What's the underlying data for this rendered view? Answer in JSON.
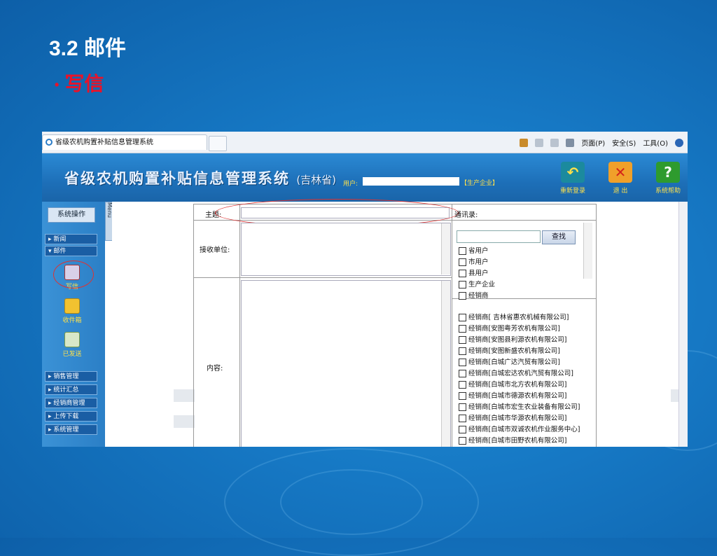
{
  "slide": {
    "title": "3.2 邮件",
    "bullet": "写信"
  },
  "browser": {
    "tab_title": "省级农机购置补贴信息管理系统",
    "tools": [
      "页面(P)",
      "安全(S)",
      "工具(O)"
    ]
  },
  "header": {
    "title": "省级农机购置补贴信息管理系统",
    "province": "(吉林省)",
    "user_label": "用户:",
    "user_role": "【生产企业】",
    "buttons": [
      {
        "label": "重新登录",
        "icon": "relogin-icon",
        "color": "#1b8a9e"
      },
      {
        "label": "退 出",
        "icon": "exit-icon",
        "color": "#e0572b"
      },
      {
        "label": "系统帮助",
        "icon": "help-icon",
        "color": "#2e9b2e"
      }
    ]
  },
  "sidebar": {
    "system_ops": "系统操作",
    "menu_tab": "Menu",
    "items_top": [
      "新闻",
      "邮件"
    ],
    "mail_actions": [
      "写信",
      "收件箱",
      "已发送"
    ],
    "items_bottom": [
      "销售管理",
      "统计汇总",
      "经销商管理",
      "上传下载",
      "系统管理"
    ]
  },
  "form": {
    "subject_label": "主题:",
    "recipient_label": "接收单位:",
    "content_label": "内容:",
    "address_book_label": "通讯录:",
    "search_button": "查找",
    "groups": [
      "省用户",
      "市用户",
      "县用户",
      "生产企业",
      "经销商"
    ],
    "dealers": [
      "经销商[ 吉林省惠农机械有限公司]",
      "经销商[安图粤芳农机有限公司]",
      "经销商[安图县利源农机有限公司]",
      "经销商[安图新盛农机有限公司]",
      "经销商[白城广达汽贸有限公司]",
      "经销商[白城宏达农机汽贸有限公司]",
      "经销商[白城市北方农机有限公司]",
      "经销商[白城市德源农机有限公司]",
      "经销商[白城市宏生农业装备有限公司]",
      "经销商[白城市华源农机有限公司]",
      "经销商[白城市双诚农机作业服务中心]",
      "经销商[白城市田野农机有限公司]"
    ]
  },
  "colors": {
    "slide_bg": "#1678c4",
    "bullet": "#e8132a",
    "header_bg": "#1d6fb8",
    "highlight_circle": "#d33333"
  }
}
